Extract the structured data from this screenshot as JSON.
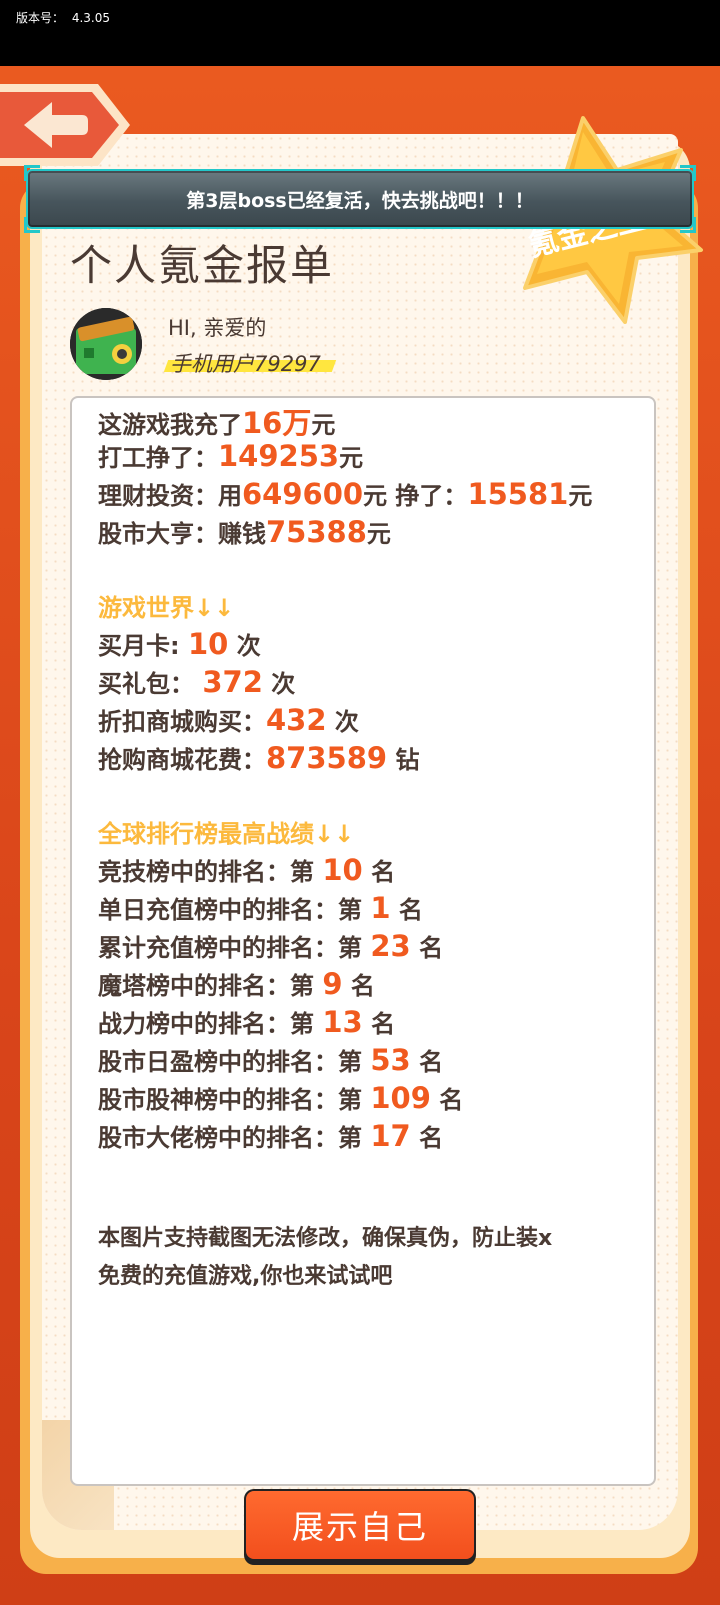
{
  "status_bar": {
    "version_label": "版本号：",
    "version": "4.3.05"
  },
  "notice": "第3层boss已经复活，快去挑战吧！！！",
  "badge_text": "氪金之王",
  "report": {
    "title": "个人氪金报单",
    "greeting": "HI, 亲爱的",
    "username": "手机用户79297"
  },
  "summary": {
    "recharge_prefix": "这游戏我充了",
    "recharge_value": "16万",
    "recharge_suffix": "元",
    "work_prefix": "打工挣了：",
    "work_value": "149253",
    "work_suffix": "元",
    "invest_prefix": "理财投资：用",
    "invest_value": "649600",
    "invest_mid": "元 挣了：",
    "invest_earn": "15581",
    "invest_suffix": "元",
    "stock_prefix": "股市大亨：赚钱",
    "stock_value": "75388",
    "stock_suffix": "元"
  },
  "game_world": {
    "title": "游戏世界↓↓",
    "items": [
      {
        "label": "买月卡:",
        "value": "10",
        "unit": "次"
      },
      {
        "label": "买礼包：",
        "value": "372",
        "unit": "次"
      },
      {
        "label": "折扣商城购买：",
        "value": "432",
        "unit": "次"
      },
      {
        "label": "抢购商城花费：",
        "value": "873589",
        "unit": "钻"
      }
    ]
  },
  "rankings": {
    "title": "全球排行榜最高战绩↓↓",
    "prefix": "第",
    "unit": "名",
    "items": [
      {
        "label": "竞技榜中的排名：",
        "value": "10"
      },
      {
        "label": "单日充值榜中的排名：",
        "value": "1"
      },
      {
        "label": "累计充值榜中的排名：",
        "value": "23"
      },
      {
        "label": "魔塔榜中的排名：",
        "value": "9"
      },
      {
        "label": "战力榜中的排名：",
        "value": "13"
      },
      {
        "label": "股市日盈榜中的排名：",
        "value": "53"
      },
      {
        "label": "股市股神榜中的排名：",
        "value": "109"
      },
      {
        "label": "股市大佬榜中的排名：",
        "value": "17"
      }
    ]
  },
  "footnote_line1": "本图片支持截图无法修改，确保真伪，防止装x",
  "footnote_line2": "免费的充值游戏,你也来试试吧",
  "show_button": "展示自己",
  "colors": {
    "accent": "#f05a1f",
    "section": "#fcb93d",
    "banner_border": "#23c7c9"
  }
}
